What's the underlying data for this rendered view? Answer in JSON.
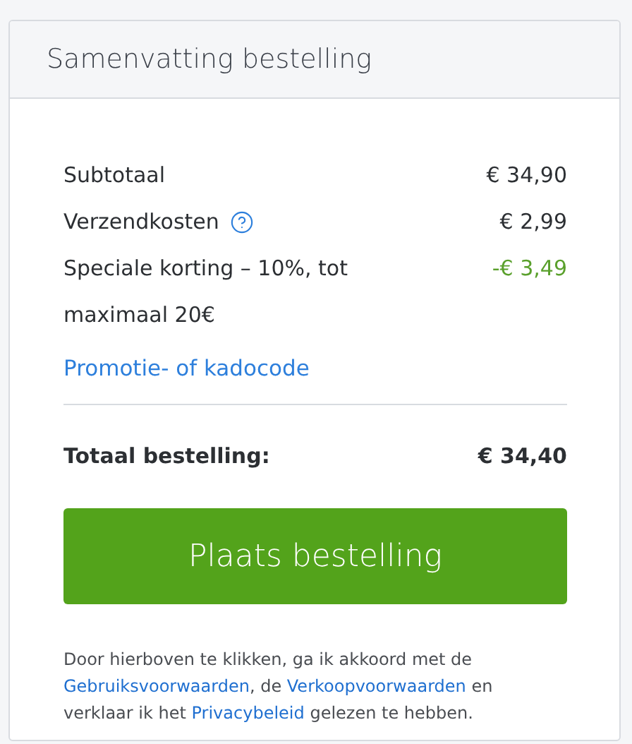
{
  "title": "Samenvatting bestelling",
  "lines": [
    {
      "label": "Subtotaal",
      "amount": "€ 34,90",
      "kind": "plain"
    },
    {
      "label": "Verzendkosten",
      "amount": "€ 2,99",
      "kind": "help"
    },
    {
      "label": "Speciale korting – 10%, tot maximaal 20€",
      "amount": "-€ 3,49",
      "kind": "discount"
    }
  ],
  "promo_link": "Promotie- of kadocode",
  "total": {
    "label": "Totaal bestelling:",
    "amount": "€ 34,40"
  },
  "button": "Plaats bestelling",
  "legal": [
    {
      "kind": "text",
      "text": "Door hierboven te klikken, ga ik akkoord met de "
    },
    {
      "kind": "link",
      "text": "Gebruiksvoorwaarden"
    },
    {
      "kind": "text",
      "text": ", de "
    },
    {
      "kind": "link",
      "text": "Verkoopvoorwaarden"
    },
    {
      "kind": "text",
      "text": " en verklaar ik het "
    },
    {
      "kind": "link",
      "text": "Privacybeleid"
    },
    {
      "kind": "text",
      "text": " gelezen te hebben."
    }
  ]
}
